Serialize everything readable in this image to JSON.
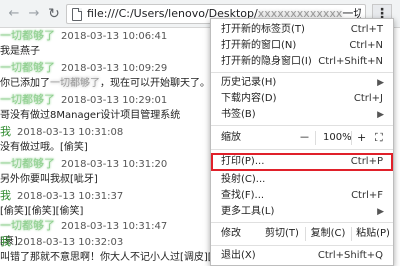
{
  "browser": {
    "url": "file:///C:/Users/lenovo/Desktop/",
    "url_tail": "一切...",
    "back_icon": "arrow-left-icon",
    "forward_icon": "arrow-right-icon",
    "reload_icon": "reload-icon",
    "page_icon": "document-icon",
    "menu_icon": "⋮"
  },
  "chat": {
    "messages": [
      {
        "name": "一切都够了",
        "blurred_name": true,
        "time": "2018-03-13 10:06:41",
        "text": "我是燕子"
      },
      {
        "name": "一切都够了",
        "blurred_name": true,
        "time": "2018-03-13 10:09:29",
        "text_prefix": "你已添加了",
        "text_blur": "一切都够了",
        "text_suffix": "，现在可以开始聊天了。"
      },
      {
        "name": "一切都够了",
        "blurred_name": true,
        "time": "2018-03-13 10:29:01",
        "text": "哥没有做过8Manager设计项目管理系统"
      },
      {
        "name": "我",
        "blurred_name": false,
        "time": "2018-03-13 10:31:08",
        "text": "没有做过哦。[偷笑]"
      },
      {
        "name": "一切都够了",
        "blurred_name": true,
        "time": "2018-03-13 10:31:20",
        "text": "另外你要叫我叔[呲牙]"
      },
      {
        "name": "我",
        "blurred_name": false,
        "time": "2018-03-13 10:31:37",
        "text": "[偷笑][偷笑][偷笑]"
      },
      {
        "name": "一切都够了",
        "blurred_name": true,
        "time": "2018-03-13 10:31:47",
        "text": "[衰]"
      },
      {
        "name": "我",
        "blurred_name": false,
        "time": "2018-03-13 10:32:03",
        "text": "叫错了那就不意思啊！你大人不记小人过[调皮][调皮]"
      }
    ]
  },
  "menu": {
    "items": [
      {
        "label": "打开新的标签页(T)",
        "shortcut": "Ctrl+T"
      },
      {
        "label": "打开新的窗口(N)",
        "shortcut": "Ctrl+N"
      },
      {
        "label": "打开新的隐身窗口(I)",
        "shortcut": "Ctrl+Shift+N"
      },
      {
        "label": "历史记录(H)",
        "arrow": "▶"
      },
      {
        "label": "下载内容(D)",
        "shortcut": "Ctrl+J"
      },
      {
        "label": "书签(B)",
        "arrow": "▶"
      },
      {
        "label": "缩放",
        "minus": "－",
        "zoom_value": "100%",
        "plus": "+",
        "fullscreen": "⛶"
      },
      {
        "label": "打印(P)...",
        "shortcut": "Ctrl+P"
      },
      {
        "label": "投射(C)..."
      },
      {
        "label": "查找(F)...",
        "shortcut": "Ctrl+F"
      },
      {
        "label": "更多工具(L)",
        "arrow": "▶"
      },
      {
        "label": "修改",
        "cut": "剪切(T)",
        "copy": "复制(C)",
        "paste": "粘贴(P)"
      },
      {
        "label": "退出(X)",
        "shortcut": "Ctrl+Shift+Q"
      }
    ],
    "highlight_color": "#e0202a"
  }
}
